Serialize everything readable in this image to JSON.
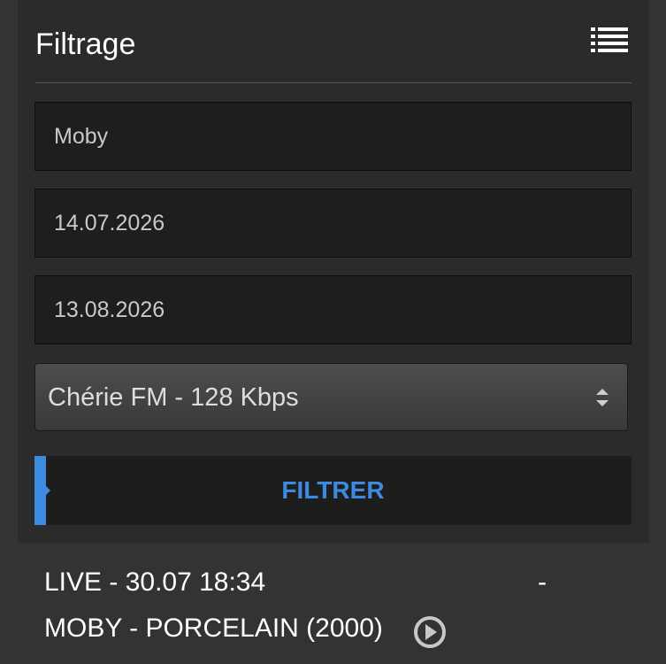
{
  "filter_panel": {
    "title": "Filtrage",
    "artist_field": {
      "value": "Moby",
      "placeholder": "Moby"
    },
    "date_from_field": {
      "value": "14.07.2026",
      "placeholder": "14.07.2026"
    },
    "date_to_field": {
      "value": "13.08.2026",
      "placeholder": "13.08.2026"
    },
    "station_select": {
      "selected": "Chérie FM - 128 Kbps"
    },
    "filter_button": {
      "label": "FILTRER"
    },
    "icons": {
      "list": "list-icon",
      "select_arrows": "sort-arrows-icon"
    }
  },
  "result": {
    "live_line": "LIVE - 30.07 18:34",
    "dash": "-",
    "track_line": "MOBY - PORCELAIN (2000)",
    "play_icon": "play-circle-icon"
  },
  "colors": {
    "background": "#333333",
    "panel": "#2b2b2b",
    "field": "#1e1e1e",
    "accent": "#3d8be0",
    "text": "#ffffff"
  }
}
